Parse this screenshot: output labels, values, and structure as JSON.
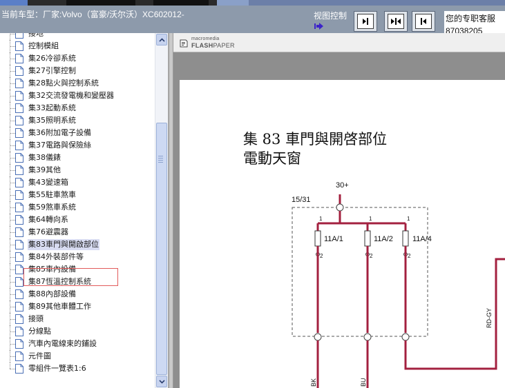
{
  "header": {
    "car_model": "当前车型：厂家:Volvo（富豪/沃尔沃）XC602012-",
    "view_control_label": "视图控制",
    "support_title": "您的专职客服",
    "support_phone": "87038205"
  },
  "sidebar": {
    "items": [
      {
        "label": "接地"
      },
      {
        "label": "控制模組"
      },
      {
        "label": "集26冷卻系統"
      },
      {
        "label": "集27引擎控制"
      },
      {
        "label": "集28點火與控制系統"
      },
      {
        "label": "集32交流發電機和變壓器"
      },
      {
        "label": "集33起動系統"
      },
      {
        "label": "集35照明系統"
      },
      {
        "label": "集36附加電子設備"
      },
      {
        "label": "集37電路與保險絲"
      },
      {
        "label": "集38儀錶"
      },
      {
        "label": "集39其他"
      },
      {
        "label": "集43變速箱"
      },
      {
        "label": "集55駐車煞車"
      },
      {
        "label": "集59煞車系統"
      },
      {
        "label": "集64轉向系"
      },
      {
        "label": "集76避震器"
      },
      {
        "label": "集83車門與開啟部位"
      },
      {
        "label": "集84外裝部件等"
      },
      {
        "label": "集85車內設備"
      },
      {
        "label": "集87恆溫控制系統"
      },
      {
        "label": "集88內部設備"
      },
      {
        "label": "集89其他車體工作"
      },
      {
        "label": "接頭"
      },
      {
        "label": "分線點"
      },
      {
        "label": "汽車內電線束的鋪設"
      },
      {
        "label": "元件圖"
      },
      {
        "label": "零組件一覽表1:6"
      }
    ],
    "selected_index": 17
  },
  "viewer": {
    "brand_small": "macromedia",
    "brand_main_bold": "FLASH",
    "brand_main_rest": "PAPER"
  },
  "document": {
    "title": "集 83 車門與開啓部位",
    "subtitle": "電動天窗",
    "power_label": "30+",
    "fuse_box_label": "15/31",
    "fuses": [
      "11A/1",
      "11A/2",
      "11A/4"
    ],
    "pin_top": "1",
    "pin_bottom": "2",
    "wire_labels": [
      "BK",
      "BU",
      "RD-GY"
    ]
  },
  "colors": {
    "header_bg": "#8d9aab",
    "wire": "#a3203f",
    "highlight_border": "#e25a5a",
    "scrollbar": "#cdd9f3"
  },
  "icons": {
    "tree_node": "document-icon",
    "next_page": "page-next-icon",
    "fit_page": "page-fit-icon",
    "prev_page": "page-prev-icon",
    "view_pointer": "view-pointer-icon",
    "flashpaper": "flashpaper-logo-icon"
  }
}
